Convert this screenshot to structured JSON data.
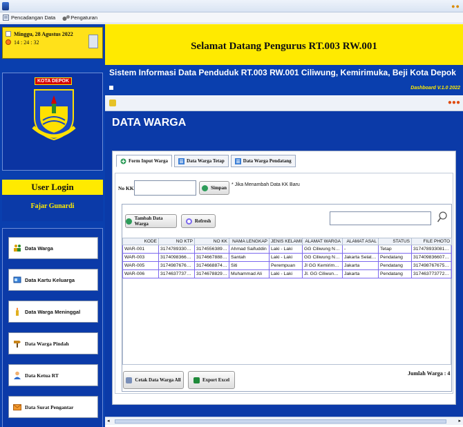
{
  "menu": {
    "items": [
      {
        "label": "Pencadangan Data",
        "icon": "backup-icon"
      },
      {
        "label": "Pengaturan",
        "icon": "gears-icon"
      }
    ]
  },
  "sidebar": {
    "date": "Minggu, 28 Agustus 2022",
    "time": "14 : 24 : 32",
    "logo_label": "KOTA DEPOK",
    "login_title": "User Login",
    "user_name": "Fajar Gunardi",
    "nav": [
      {
        "label": "Data Warga",
        "icon": "people-icon"
      },
      {
        "label": "Data Kartu Keluarga",
        "icon": "card-icon"
      },
      {
        "label": "Data Warga Meninggal",
        "icon": "candle-icon"
      },
      {
        "label": "Data Warga Pindah",
        "icon": "signpost-icon"
      },
      {
        "label": "Data Ketua RT",
        "icon": "user-icon"
      },
      {
        "label": "Data Surat Pengantar",
        "icon": "envelope-icon"
      }
    ]
  },
  "banner": {
    "text": "Selamat Datang Pengurus RT.003 RW.001"
  },
  "strip": {
    "title": "Sistem Informasi Data Penduduk RT.003 RW.001 Ciliwung, Kemirimuka, Beji Kota Depok",
    "version": "Dashboard V.1.0 2022"
  },
  "inner": {
    "heading": "DATA WARGA"
  },
  "tabs": [
    {
      "label": "Form Input Warga"
    },
    {
      "label": "Data Warga Tetap"
    },
    {
      "label": "Data Warga Pendatang"
    }
  ],
  "form": {
    "nokk_label": "No KK",
    "nokk_value": "",
    "save_label": "Simpan",
    "hint": "* Jika Menambah Data KK Baru"
  },
  "grid": {
    "add_label": "Tambah Data Warga",
    "refresh_label": "Refresh",
    "search_value": "",
    "columns": [
      "KODE",
      "NO KTP",
      "NO KK",
      "NAMA LENGKAP",
      "JENIS KELAMIN",
      "ALAMAT WARGA",
      "ALAMAT ASAL",
      "STATUS",
      "FILE PHOTO"
    ],
    "rows": [
      [
        "WAR-001",
        "3174789330812...",
        "3174556389120...",
        "Ahmad Saifuddin",
        "Laki - Laki",
        "GG Ciliwung No ...",
        "-",
        "Tetap",
        "3174789330812..."
      ],
      [
        "WAR-003",
        "3174098366070...",
        "3174667888070...",
        "Santah",
        "Laki - Laki",
        "GG Ciliwung No ...",
        "Jakarta Selatan",
        "Pendatang",
        "3174098366070..."
      ],
      [
        "WAR-005",
        "3174987676757...",
        "3174668874447...",
        "Siti",
        "Perempuan",
        "Jl GG Kemirimuka ...",
        "Jakarta",
        "Pendatang",
        "3174987676757..."
      ],
      [
        "WAR-006",
        "3174637737727...",
        "3174678829900...",
        "Muhammad Ali",
        "Laki - Laki",
        "Jl. GG Ciliwung, ...",
        "Jakarta",
        "Pendatang",
        "3174637737727..."
      ]
    ],
    "print_label": "Cetak Data Warga All",
    "export_label": "Export Excel",
    "total": "Jumlah Warga : 4"
  }
}
